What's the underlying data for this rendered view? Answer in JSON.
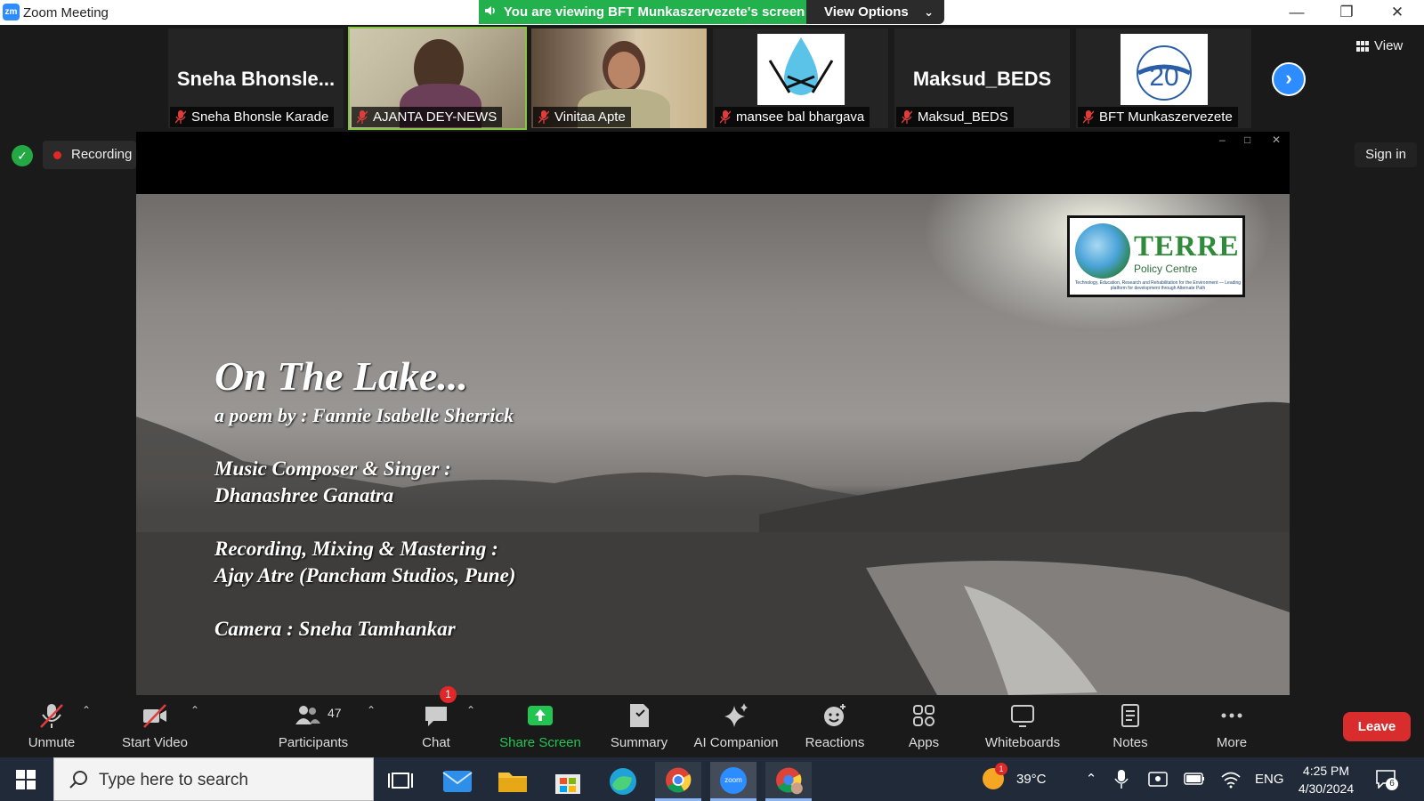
{
  "window": {
    "app_logo": "zm",
    "title": "Zoom Meeting",
    "viewing_banner": "You are viewing BFT Munkaszervezete's screen",
    "view_options": "View Options"
  },
  "gallery": {
    "view_label": "View",
    "tiles": [
      {
        "big_name": "Sneha  Bhonsle...",
        "name": "Sneha Bhonsle Karade"
      },
      {
        "name": "AJANTA DEY-NEWS"
      },
      {
        "name": "Vinitaa Apte"
      },
      {
        "name": "mansee bal bhargava"
      },
      {
        "big_name": "Maksud_BEDS",
        "name": "Maksud_BEDS"
      },
      {
        "name": "BFT Munkaszervezete",
        "logo_text": "20"
      }
    ]
  },
  "status": {
    "recording": "Recording",
    "sign_in": "Sign in"
  },
  "shared_content": {
    "title": "On The Lake...",
    "subtitle": "a poem by : Fannie Isabelle Sherrick",
    "credits": [
      "Music Composer & Singer :",
      "Dhanashree Ganatra",
      "Recording, Mixing & Mastering :",
      "Ajay Atre (Pancham Studios, Pune)",
      "Camera : Sneha Tamhankar"
    ],
    "logo": {
      "name": "TERRE",
      "sub": "Policy Centre",
      "tagline": "Technology, Education, Research and Rehabilitation for the Environment — Leading platform for development through Alternate Path"
    }
  },
  "toolbar": {
    "unmute": "Unmute",
    "start_video": "Start Video",
    "participants": "Participants",
    "participants_count": "47",
    "chat": "Chat",
    "chat_badge": "1",
    "share_screen": "Share Screen",
    "summary": "Summary",
    "ai_companion": "AI Companion",
    "reactions": "Reactions",
    "apps": "Apps",
    "whiteboards": "Whiteboards",
    "notes": "Notes",
    "more": "More",
    "leave": "Leave"
  },
  "taskbar": {
    "search_placeholder": "Type here to search",
    "weather": "39°C",
    "weather_badge": "1",
    "lang": "ENG",
    "time": "4:25 PM",
    "date": "4/30/2024",
    "notif_count": "6",
    "zoom_label": "zoom"
  },
  "colors": {
    "zoom_blue": "#2d8cff",
    "banner_green": "#23b14d",
    "share_green": "#23c552",
    "leave_red": "#d92d2d"
  }
}
